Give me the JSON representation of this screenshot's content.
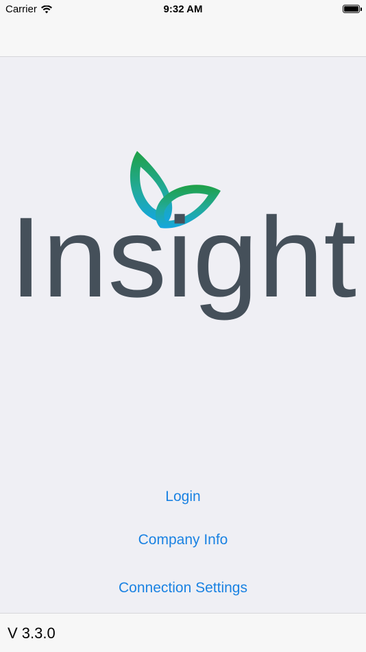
{
  "status_bar": {
    "carrier": "Carrier",
    "time": "9:32 AM",
    "wifi_icon": "wifi-icon",
    "battery_icon": "battery-icon",
    "battery_level": 1.0
  },
  "brand": {
    "wordmark": "Insight",
    "logo_text_color": "#45505a",
    "leaf_gradient_top": "#1fa046",
    "leaf_gradient_bottom": "#14a6e0"
  },
  "menu": {
    "login": "Login",
    "company_info": "Company Info",
    "connection_settings": "Connection Settings",
    "link_color": "#1a82e2"
  },
  "footer": {
    "version": "V 3.3.0"
  }
}
